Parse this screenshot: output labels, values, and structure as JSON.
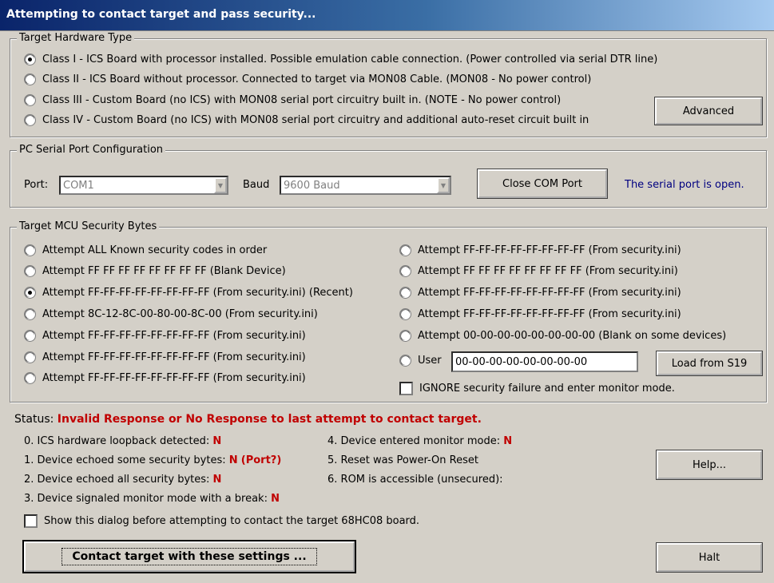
{
  "title": "Attempting to contact target and pass security...",
  "hardware": {
    "legend": "Target Hardware Type",
    "options": [
      {
        "label": "Class I - ICS Board with processor installed. Possible emulation cable connection. (Power controlled via serial DTR line)",
        "checked": true
      },
      {
        "label": "Class II - ICS Board without processor. Connected to target via MON08 Cable. (MON08 - No power control)",
        "checked": false
      },
      {
        "label": "Class III - Custom Board (no ICS) with MON08 serial port circuitry built in. (NOTE - No power control)",
        "checked": false
      },
      {
        "label": "Class IV - Custom Board (no ICS) with MON08 serial port circuitry and additional auto-reset circuit built in",
        "checked": false
      }
    ],
    "advanced_label": "Advanced"
  },
  "serial": {
    "legend": "PC Serial Port Configuration",
    "port_label": "Port:",
    "port_value": "COM1",
    "baud_label": "Baud",
    "baud_value": "9600 Baud",
    "close_label": "Close COM Port",
    "status": "The serial port is open."
  },
  "security": {
    "legend": "Target MCU Security Bytes",
    "left": [
      {
        "label": "Attempt ALL Known security codes in order",
        "checked": false
      },
      {
        "label": "Attempt FF FF FF FF FF FF FF FF (Blank Device)",
        "checked": false
      },
      {
        "label": "Attempt FF-FF-FF-FF-FF-FF-FF-FF (From security.ini) (Recent)",
        "checked": true
      },
      {
        "label": "Attempt 8C-12-8C-00-80-00-8C-00 (From security.ini)",
        "checked": false
      },
      {
        "label": "Attempt FF-FF-FF-FF-FF-FF-FF-FF (From security.ini)",
        "checked": false
      },
      {
        "label": "Attempt FF-FF-FF-FF-FF-FF-FF-FF (From security.ini)",
        "checked": false
      },
      {
        "label": "Attempt FF-FF-FF-FF-FF-FF-FF-FF (From security.ini)",
        "checked": false
      }
    ],
    "right": [
      {
        "label": "Attempt FF-FF-FF-FF-FF-FF-FF-FF (From security.ini)",
        "checked": false
      },
      {
        "label": "Attempt FF FF FF FF FF FF FF FF (From security.ini)",
        "checked": false
      },
      {
        "label": "Attempt FF-FF-FF-FF-FF-FF-FF-FF (From security.ini)",
        "checked": false
      },
      {
        "label": "Attempt FF-FF-FF-FF-FF-FF-FF-FF (From security.ini)",
        "checked": false
      },
      {
        "label": "Attempt 00-00-00-00-00-00-00-00 (Blank on some devices)",
        "checked": false
      }
    ],
    "user_label": "User",
    "user_value": "00-00-00-00-00-00-00-00",
    "load_label": "Load from S19",
    "ignore_label": "IGNORE security failure and enter monitor mode."
  },
  "status": {
    "prefix": "Status:",
    "message": "Invalid Response or No Response to last attempt to contact target.",
    "items_left": [
      {
        "text": "0. ICS hardware loopback detected:",
        "value": "N",
        "extra": ""
      },
      {
        "text": "1. Device echoed some security bytes:",
        "value": "N",
        "extra": "(Port?)"
      },
      {
        "text": "2. Device echoed all security bytes:",
        "value": "N",
        "extra": ""
      },
      {
        "text": "3. Device signaled monitor mode with a break:",
        "value": "N",
        "extra": ""
      }
    ],
    "items_right": [
      {
        "text": "4. Device entered monitor mode:",
        "value": "N"
      },
      {
        "text": "5. Reset was Power-On Reset",
        "value": ""
      },
      {
        "text": "6. ROM is accessible (unsecured):",
        "value": ""
      }
    ],
    "help_label": "Help...",
    "show_label": "Show this dialog before attempting to contact the target 68HC08 board.",
    "contact_label": "Contact target with these settings ...",
    "halt_label": "Halt"
  }
}
